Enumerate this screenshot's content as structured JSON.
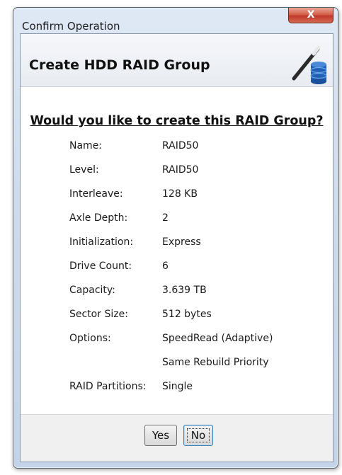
{
  "window": {
    "title": "Confirm Operation",
    "close_glyph": "X"
  },
  "header": {
    "title": "Create HDD RAID Group",
    "icon": "wand-disk-icon"
  },
  "question": "Would you like to create this RAID Group?",
  "details": [
    {
      "label": "Name:",
      "value": "RAID50"
    },
    {
      "label": "Level:",
      "value": "RAID50"
    },
    {
      "label": "Interleave:",
      "value": "128 KB"
    },
    {
      "label": "Axle Depth:",
      "value": "2"
    },
    {
      "label": "Initialization:",
      "value": "Express"
    },
    {
      "label": "Drive Count:",
      "value": "6"
    },
    {
      "label": "Capacity:",
      "value": "3.639 TB"
    },
    {
      "label": "Sector Size:",
      "value": "512 bytes"
    },
    {
      "label": "Options:",
      "value": "SpeedRead (Adaptive)"
    },
    {
      "label": "",
      "value": "Same Rebuild Priority"
    },
    {
      "label": "RAID Partitions:",
      "value": "Single"
    }
  ],
  "buttons": {
    "yes": "Yes",
    "no": "No"
  },
  "colors": {
    "close_button": "#c0392b",
    "disk_icon": "#1f5fb5"
  }
}
